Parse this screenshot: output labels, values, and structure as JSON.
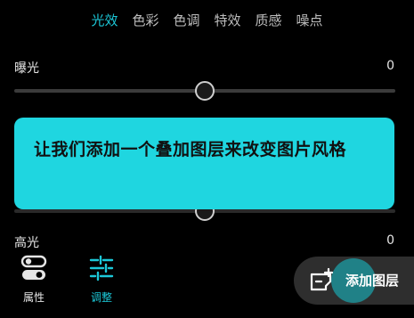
{
  "tabs": [
    {
      "label": "光效",
      "active": true
    },
    {
      "label": "色彩",
      "active": false
    },
    {
      "label": "色调",
      "active": false
    },
    {
      "label": "特效",
      "active": false
    },
    {
      "label": "质感",
      "active": false
    },
    {
      "label": "噪点",
      "active": false
    }
  ],
  "sliders": {
    "exposure": {
      "label": "曝光",
      "value": "0",
      "level": 0.5
    },
    "highlight": {
      "label": "高光",
      "value": "0",
      "level": 0.5
    }
  },
  "bubble": {
    "text": "让我们添加一个叠加图层来改变图片风格"
  },
  "bottom": {
    "attributes_label": "属性",
    "adjust_label": "调整",
    "add_layer_label": "添加图层"
  },
  "colors": {
    "accent": "#1cc8d8",
    "bubble": "#1fd6e0",
    "background": "#000000"
  },
  "icons": {
    "attributes": "toggle-switches-icon",
    "adjust": "sliders-adjust-icon",
    "add_layer": "add-layer-icon"
  }
}
